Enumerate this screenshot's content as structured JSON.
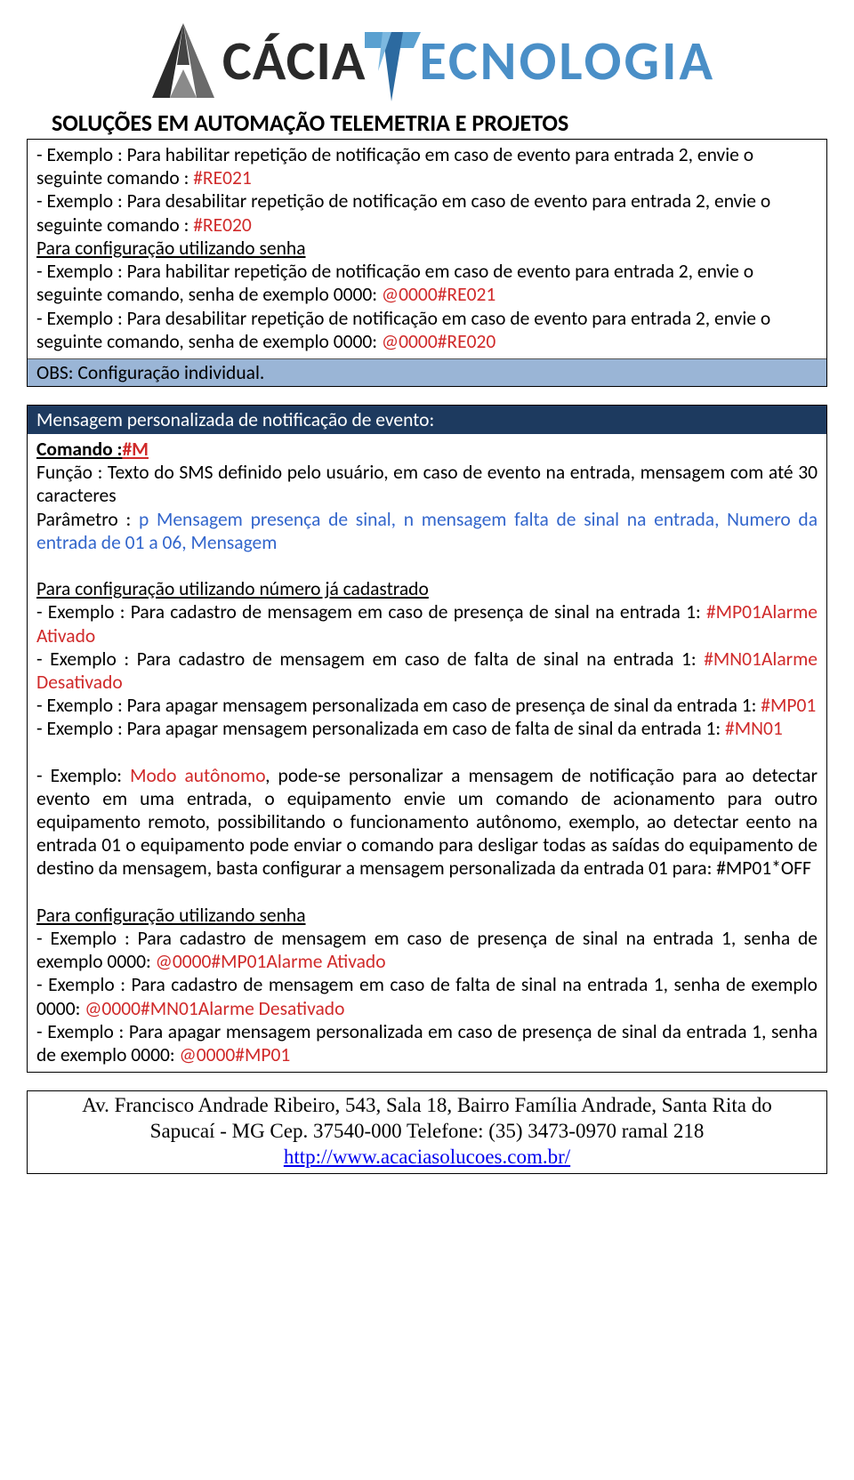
{
  "header": {
    "brand1": "CÁCIA",
    "brand2": "ECNOLOGIA",
    "tagline": "SOLUÇÕES EM AUTOMAÇÃO TELEMETRIA E PROJETOS"
  },
  "box1": {
    "l1a": "- Exemplo : Para habilitar repetição de notificação em caso de evento para entrada 2, envie o seguinte comando : ",
    "l1b": "#RE021",
    "l2a": "- Exemplo : Para desabilitar repetição de notificação em caso de evento para entrada 2, envie o seguinte comando : ",
    "l2b": "#RE020",
    "sub1": "Para configuração utilizando senha",
    "l3a": "- Exemplo : Para habilitar repetição de notificação em caso de evento para entrada 2, envie o seguinte comando, senha de exemplo 0000: ",
    "l3b": "@0000#RE021",
    "l4a": "- Exemplo : Para desabilitar repetição de notificação em caso de evento para entrada 2, envie o seguinte comando, senha de exemplo 0000: ",
    "l4b": "@0000#RE020",
    "obs": "OBS: Configuração individual."
  },
  "box2": {
    "title": "Mensagem personalizada de notificação de evento:",
    "cmd_label": "Comando :",
    "cmd_value": "#M",
    "func": "Função : Texto do SMS definido pelo usuário, em caso de evento na entrada, mensagem com até 30 caracteres",
    "param_label": "Parâmetro : ",
    "param_text": "p Mensagem presença de sinal, n mensagem falta de sinal na entrada, Numero da entrada de 01 a 06, Mensagem",
    "sub1": "Para configuração utilizando número já cadastrado",
    "e1a": "- Exemplo : Para cadastro de mensagem em caso de presença de sinal na entrada 1: ",
    "e1b": "#MP01Alarme Ativado",
    "e2a": "- Exemplo : Para cadastro de mensagem em caso de falta de sinal na entrada 1: ",
    "e2b": "#MN01Alarme Desativado",
    "e3a": "- Exemplo : Para apagar mensagem personalizada em caso de presença de sinal da entrada 1: ",
    "e3b": "#MP01",
    "e4a": "- Exemplo : Para apagar mensagem personalizada em caso de falta de sinal da entrada 1: ",
    "e4b": "#MN01",
    "auto_prefix": "- Exemplo: ",
    "auto_red": "Modo autônomo",
    "auto_rest": ", pode-se personalizar a mensagem de notificação para ao detectar evento em uma entrada, o equipamento envie um comando de acionamento para outro equipamento remoto, possibilitando o funcionamento autônomo, exemplo, ao detectar eento na entrada 01 o equipamento pode enviar o comando para desligar todas as saídas do equipamento de destino da mensagem, basta configurar a mensagem personalizada da entrada 01 para: #MP01*OFF",
    "sub2": "Para configuração utilizando senha",
    "s1a": "- Exemplo : Para cadastro de mensagem em caso de presença de sinal na entrada 1, senha de exemplo 0000: ",
    "s1b": "@0000#MP01Alarme Ativado",
    "s2a": "- Exemplo : Para cadastro de mensagem em caso de falta de sinal na entrada 1, senha de exemplo 0000: ",
    "s2b": "@0000#MN01Alarme Desativado",
    "s3a": "- Exemplo : Para apagar mensagem personalizada em caso de presença de sinal da entrada 1, senha de exemplo 0000: ",
    "s3b": "@0000#MP01"
  },
  "footer": {
    "line1": "Av. Francisco Andrade Ribeiro, 543, Sala 18, Bairro Família Andrade, Santa Rita do",
    "line2": "Sapucaí - MG Cep. 37540-000 Telefone: (35) 3473-0970 ramal 218",
    "url": "http://www.acaciasolucoes.com.br/"
  }
}
